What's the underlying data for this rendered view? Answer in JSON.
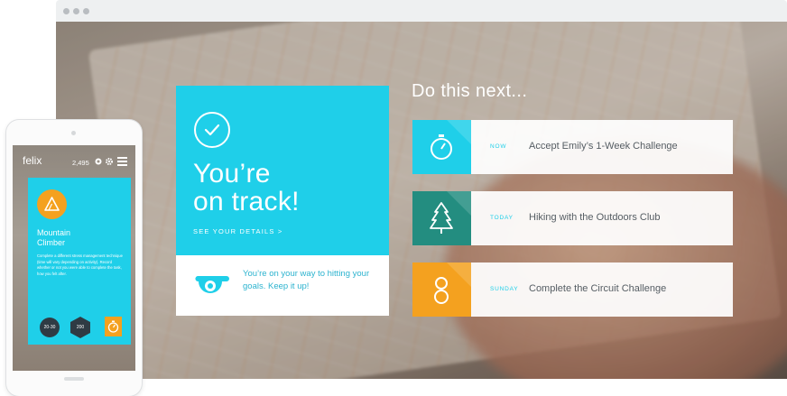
{
  "browser": {
    "dots": 3
  },
  "main_card": {
    "headline_line1": "You’re",
    "headline_line2": "on track!",
    "details_link": "SEE YOUR DETAILS >",
    "message": "You’re on your way to hitting your goals. Keep it up!"
  },
  "next": {
    "title": "Do this next...",
    "tasks": [
      {
        "when": "NOW",
        "label": "Accept Emily’s 1-Week Challenge",
        "icon": "stopwatch-icon",
        "color": "#1fcfe9"
      },
      {
        "when": "TODAY",
        "label": "Hiking with the Outdoors Club",
        "icon": "tree-icon",
        "color": "#238d80"
      },
      {
        "when": "SUNDAY",
        "label": "Complete the Circuit Challenge",
        "icon": "circuit-icon",
        "color": "#f4a11f"
      }
    ]
  },
  "phone": {
    "logo": "felix",
    "points": "2,495",
    "card_title_line1": "Mountain",
    "card_title_line2": "Climber",
    "card_desc": "Complete a different stress management technique (time will vary depending on activity). Record whether or not you were able to complete the task, how you felt after.",
    "stat1": "20-30",
    "stat2": "200"
  },
  "colors": {
    "accent": "#1fcfe9",
    "teal": "#238d80",
    "orange": "#f4a11f",
    "dark": "#2f3b44"
  }
}
